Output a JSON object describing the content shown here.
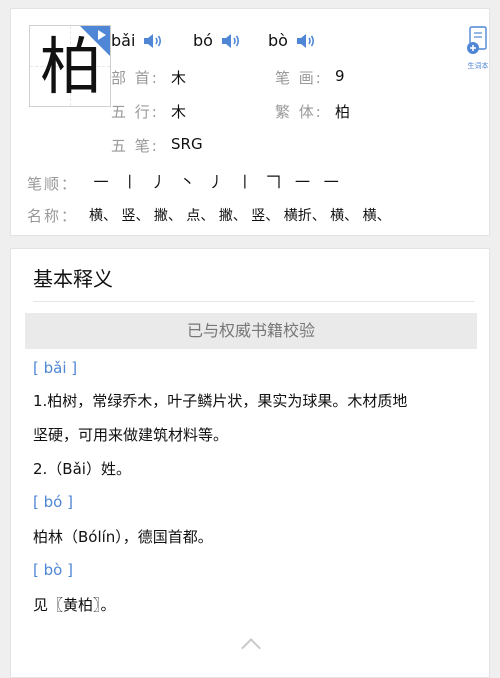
{
  "character": {
    "glyph": "柏",
    "pronunciations": [
      "bǎi",
      "bó",
      "bò"
    ],
    "new_word_label": "生词本",
    "fields": {
      "radical_label": "部 首:",
      "radical": "木",
      "strokes_label": "笔 画:",
      "strokes": "9",
      "wuxing_label": "五 行:",
      "wuxing": "木",
      "traditional_label": "繁 体:",
      "traditional": "柏",
      "wubi_label": "五 笔:",
      "wubi": "SRG"
    },
    "stroke_order_label": "笔顺：",
    "stroke_order": [
      "一",
      "丨",
      "丿",
      "丶",
      "丿",
      "丨",
      "𠃍",
      "一",
      "一"
    ],
    "stroke_names_label": "名称：",
    "stroke_names": [
      "横、",
      "竖、",
      "撇、",
      "点、",
      "撇、",
      "竖、",
      "横折、",
      "横、",
      "横、"
    ]
  },
  "basic_meaning": {
    "title": "基本释义",
    "verified_label": "已与权威书籍校验",
    "entries": [
      {
        "pinyin": "[ bǎi ]",
        "lines": [
          "1.柏树，常绿乔木，叶子鳞片状，果实为球果。木材质地",
          "坚硬，可用来做建筑材料等。",
          "2.（Bǎi）姓。"
        ]
      },
      {
        "pinyin": "[ bó ]",
        "lines": [
          "柏林（Bólín），德国首都。"
        ]
      },
      {
        "pinyin": "[ bò ]",
        "lines": [
          "见〖黄柏〗。"
        ]
      }
    ]
  },
  "colors": {
    "accent": "#4f86d6",
    "label_gray": "#999999",
    "background": "#efeff0"
  }
}
